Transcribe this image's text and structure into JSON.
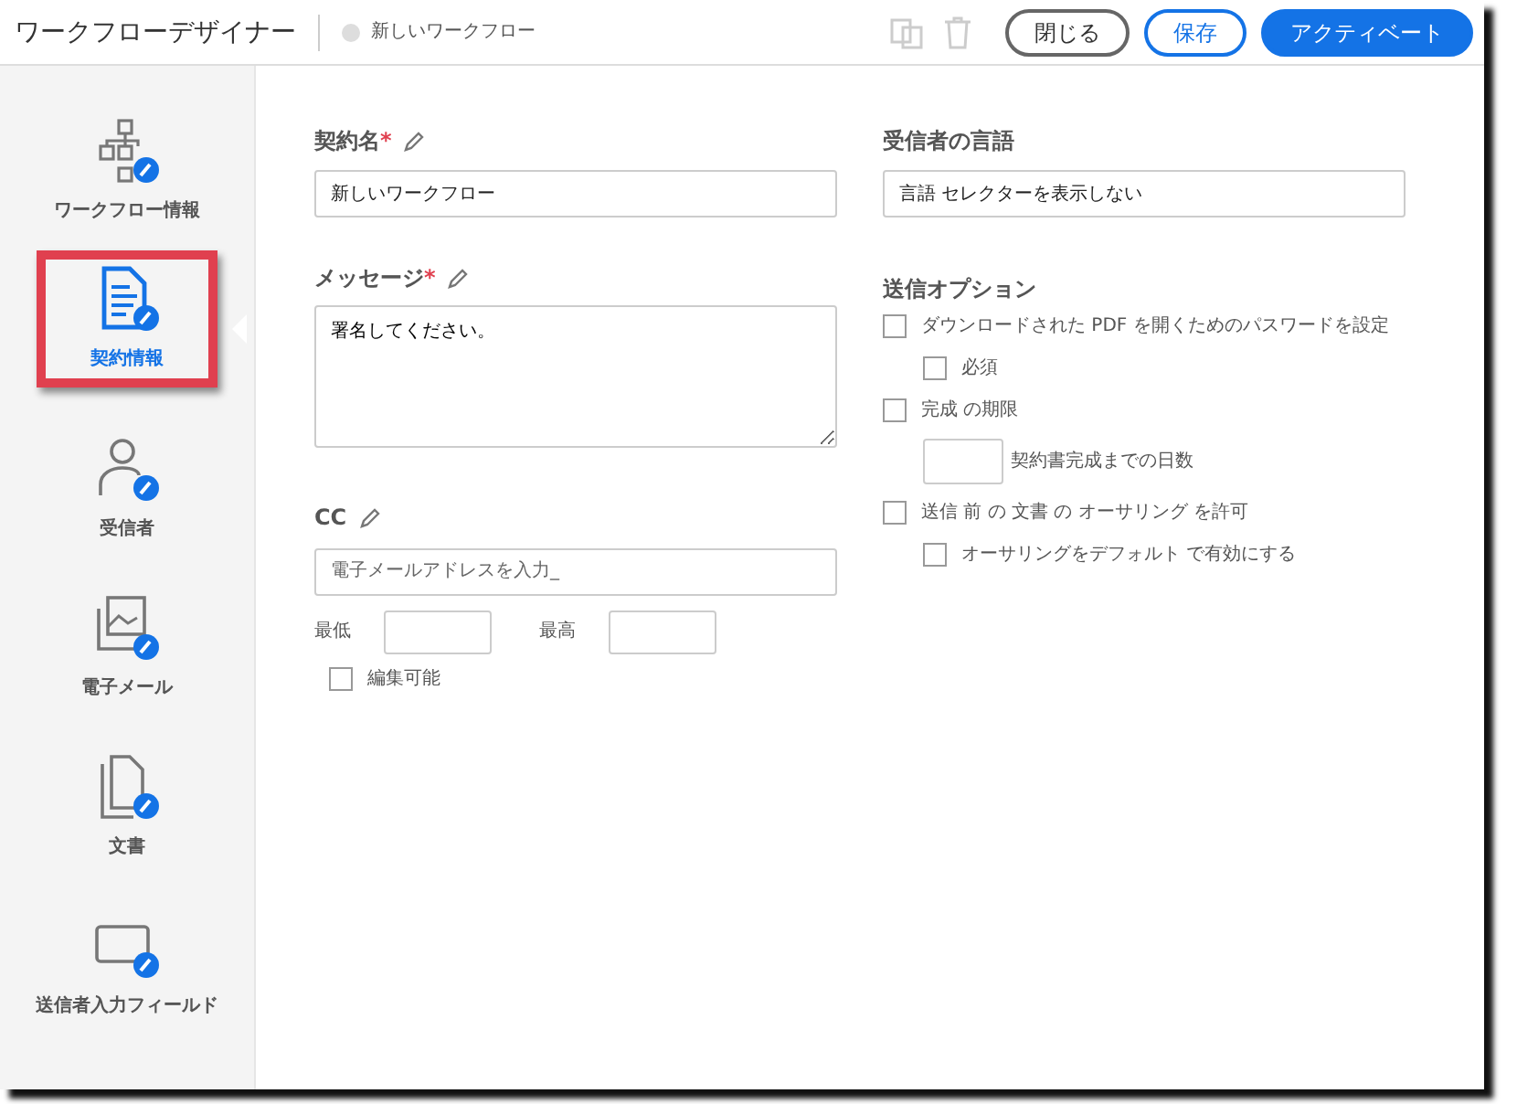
{
  "header": {
    "title": "ワークフローデザイナー",
    "workflow_name": "新しいワークフロー",
    "toolbar_icons": [
      {
        "kind": "copy",
        "disabled": true
      },
      {
        "kind": "trash",
        "disabled": true
      }
    ],
    "buttons": [
      {
        "label": "閉じる",
        "kind": "secondary"
      },
      {
        "label": "保存",
        "kind": "outline"
      },
      {
        "label": "アクティベート",
        "kind": "primary"
      }
    ]
  },
  "sidebar": {
    "items": [
      {
        "label": "ワークフロー情報",
        "kind": "workflow",
        "selected": false
      },
      {
        "label": "契約情報",
        "kind": "document",
        "selected": true
      },
      {
        "label": "受信者",
        "kind": "person",
        "selected": false
      },
      {
        "label": "電子メール",
        "kind": "email",
        "selected": false
      },
      {
        "label": "文書",
        "kind": "files",
        "selected": false
      },
      {
        "label": "送信者入力フィールド",
        "kind": "field",
        "selected": false
      }
    ]
  },
  "agreement_name": {
    "label": "契約名",
    "required_mark": "*",
    "value": "新しいワークフロー"
  },
  "message": {
    "label": "メッセージ",
    "required_mark": "*",
    "value": "署名してください。"
  },
  "cc": {
    "label": "CC",
    "placeholder": "電子メールアドレスを入力_",
    "min_label": "最低",
    "max_label": "最高",
    "editable": {
      "label": "編集可能",
      "checked": false
    }
  },
  "recipient_language": {
    "label": "受信者の言語",
    "value": "言語 セレクターを表示しない"
  },
  "send_options": {
    "title": "送信オプション",
    "items": [
      {
        "kind": "checkbox",
        "label": "ダウンロードされた PDF を開くためのパスワードを設定",
        "checked": false,
        "children": [
          {
            "kind": "checkbox",
            "label": "必須",
            "checked": false
          }
        ]
      },
      {
        "kind": "checkbox",
        "label": "完成 の期限",
        "checked": false,
        "children": [
          {
            "kind": "number",
            "label": "契約書完成までの日数"
          }
        ]
      },
      {
        "kind": "checkbox",
        "label": "送信 前 の 文書 の オーサリング を許可",
        "checked": false,
        "children": [
          {
            "kind": "checkbox",
            "label": "オーサリングをデフォルト で有効にする",
            "checked": false
          }
        ]
      }
    ]
  }
}
